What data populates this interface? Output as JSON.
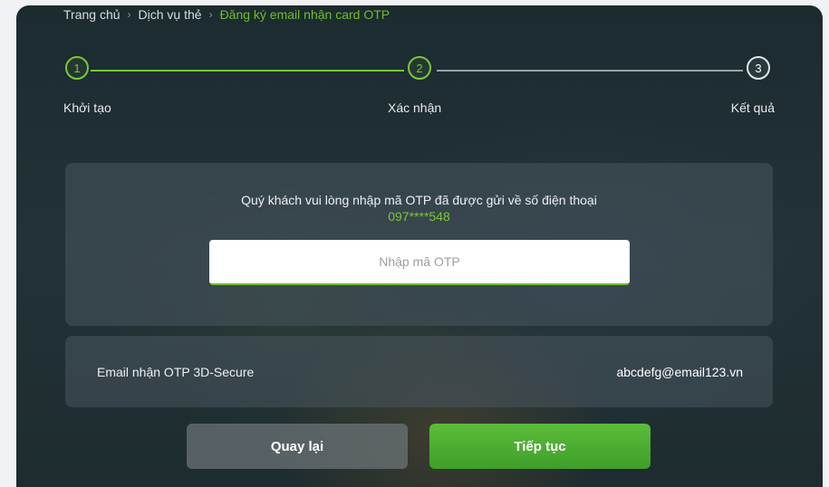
{
  "breadcrumb": {
    "home": "Trang chủ",
    "section": "Dịch vụ thẻ",
    "current": "Đăng ký email nhận card OTP",
    "separator": "›"
  },
  "stepper": {
    "steps": [
      {
        "number": "1",
        "label": "Khởi tạo",
        "state": "done"
      },
      {
        "number": "2",
        "label": "Xác nhận",
        "state": "active"
      },
      {
        "number": "3",
        "label": "Kết quả",
        "state": "pending"
      }
    ]
  },
  "otp": {
    "instruction": "Quý khách vui lòng nhập mã OTP đã được gửi về số điện thoại",
    "phone": "097****548",
    "input_value": "",
    "input_placeholder": "Nhập mã OTP"
  },
  "email": {
    "label": "Email nhận OTP 3D-Secure",
    "value": "abcdefg@email123.vn"
  },
  "actions": {
    "back_label": "Quay lại",
    "next_label": "Tiếp tục"
  },
  "colors": {
    "accent": "#7cc53b",
    "background": "#1e2c2f",
    "card": "#48565e"
  }
}
